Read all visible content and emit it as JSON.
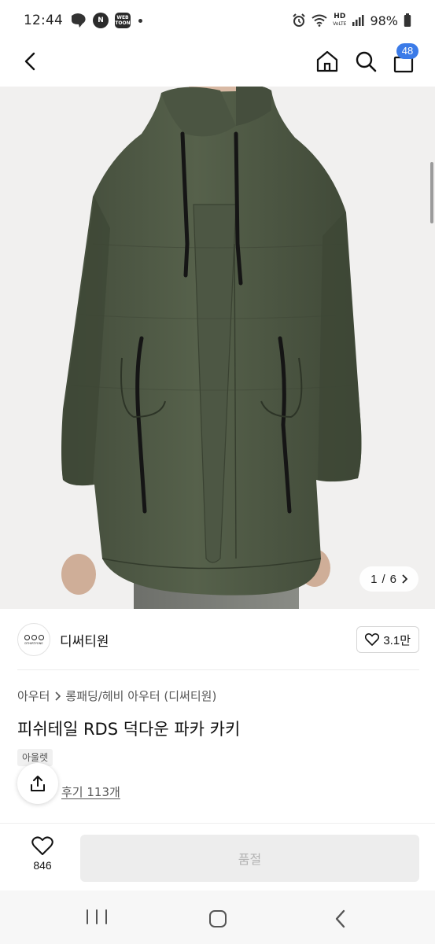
{
  "status_bar": {
    "time": "12:44",
    "apps": [
      "N",
      "WEB TOON"
    ],
    "hd_label": "HD",
    "hd_sub": "VoLTE",
    "battery": "98%"
  },
  "header": {
    "cart_count": "48"
  },
  "gallery": {
    "current": "1",
    "separator": "/",
    "total": "6"
  },
  "brand": {
    "logo_text": "DTHIRTYONE",
    "name": "디써티원",
    "likes": "3.1만"
  },
  "breadcrumb": {
    "category": "아우터",
    "sub_category": "롱패딩/헤비 아우터 (디써티원)"
  },
  "product": {
    "title": "피쉬테일 RDS 덕다운 파카 카키",
    "tag": "아울렛",
    "reviews": "후기 113개"
  },
  "purchase_bar": {
    "wish_count": "846",
    "status_button": "품절"
  },
  "colors": {
    "accent_badge": "#3b7be8",
    "jacket_khaki": "#4f5a45",
    "soldout_bg": "#ededed"
  }
}
